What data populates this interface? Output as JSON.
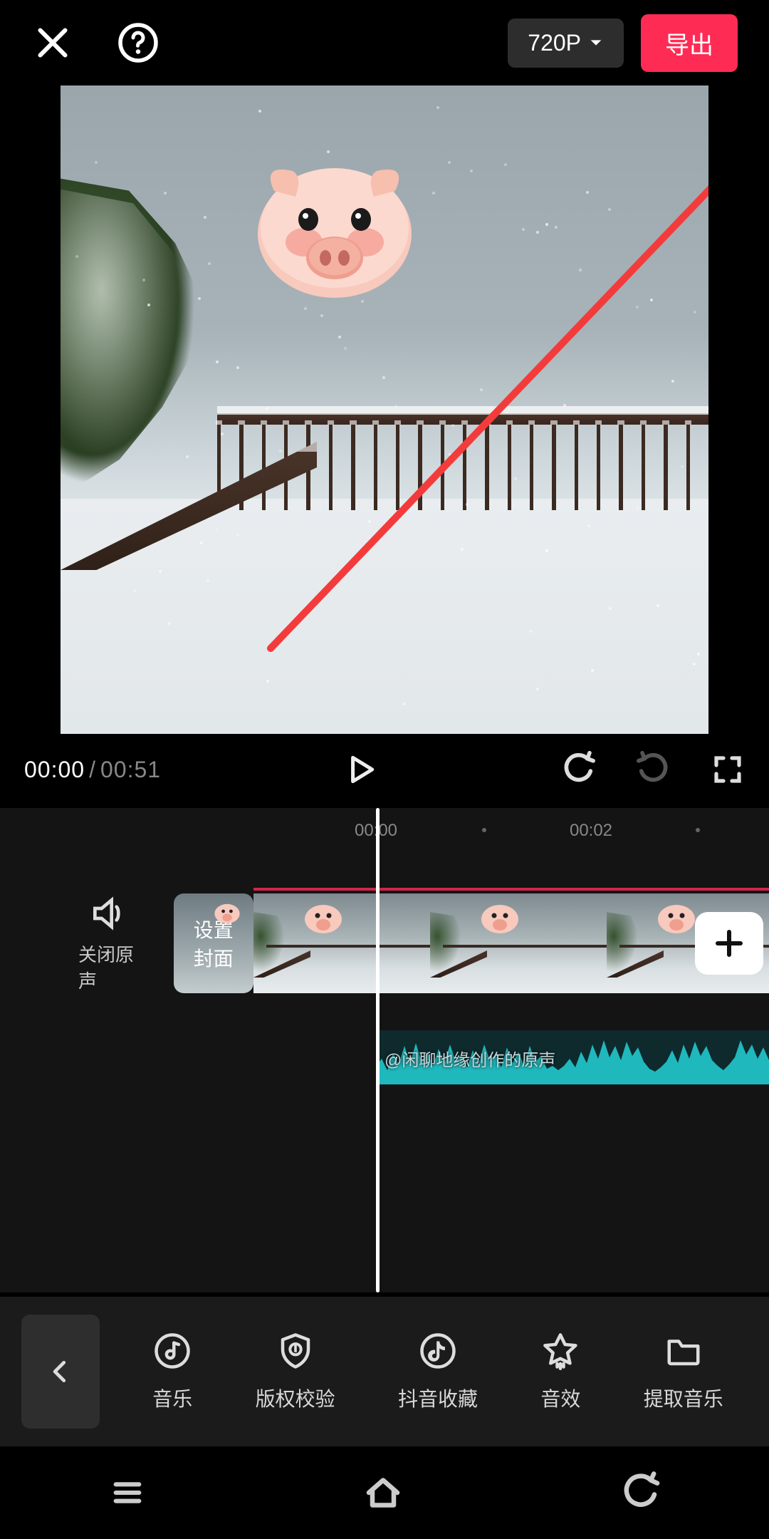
{
  "header": {
    "resolution_label": "720P",
    "export_label": "导出"
  },
  "preview": {
    "sticker_name": "pig-face",
    "annotation": "red-arrow"
  },
  "playback": {
    "current_time": "00:00",
    "duration": "00:51"
  },
  "timeline": {
    "ruler": [
      "00:00",
      "00:02"
    ],
    "mute_label": "关闭原声",
    "cover_button_line1": "设置",
    "cover_button_line2": "封面",
    "audio_track_label": "@闲聊地缘创作的原声"
  },
  "bottom_tools": [
    {
      "name": "music",
      "label": "音乐"
    },
    {
      "name": "copyright",
      "label": "版权校验"
    },
    {
      "name": "douyin",
      "label": "抖音收藏"
    },
    {
      "name": "sfx",
      "label": "音效"
    },
    {
      "name": "extract",
      "label": "提取音乐"
    }
  ]
}
